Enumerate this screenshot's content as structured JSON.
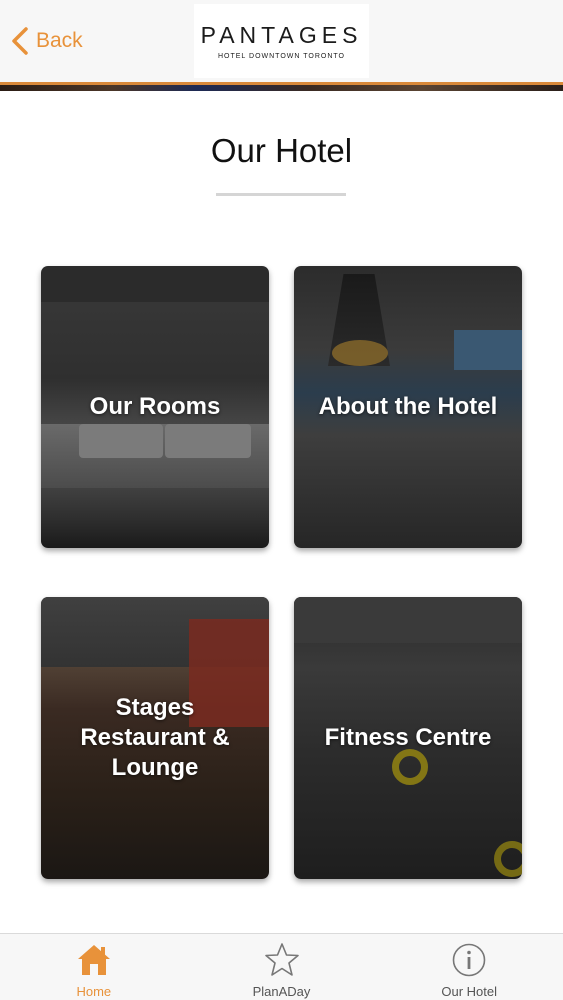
{
  "header": {
    "back_label": "Back",
    "logo": {
      "name": "PANTAGES",
      "tagline": "HOTEL DOWNTOWN TORONTO"
    }
  },
  "page": {
    "title": "Our Hotel"
  },
  "cards": [
    {
      "label": "Our Rooms"
    },
    {
      "label": "About the Hotel"
    },
    {
      "label": "Stages Restaurant & Lounge"
    },
    {
      "label": "Fitness Centre"
    }
  ],
  "tabbar": {
    "tabs": [
      {
        "label": "Home",
        "icon": "home-icon",
        "active": true
      },
      {
        "label": "PlanADay",
        "icon": "star-icon",
        "active": false
      },
      {
        "label": "Our Hotel",
        "icon": "info-icon",
        "active": false
      }
    ]
  },
  "colors": {
    "accent": "#e8923a",
    "header_bg": "#f7f7f7",
    "tab_inactive": "#555555"
  }
}
